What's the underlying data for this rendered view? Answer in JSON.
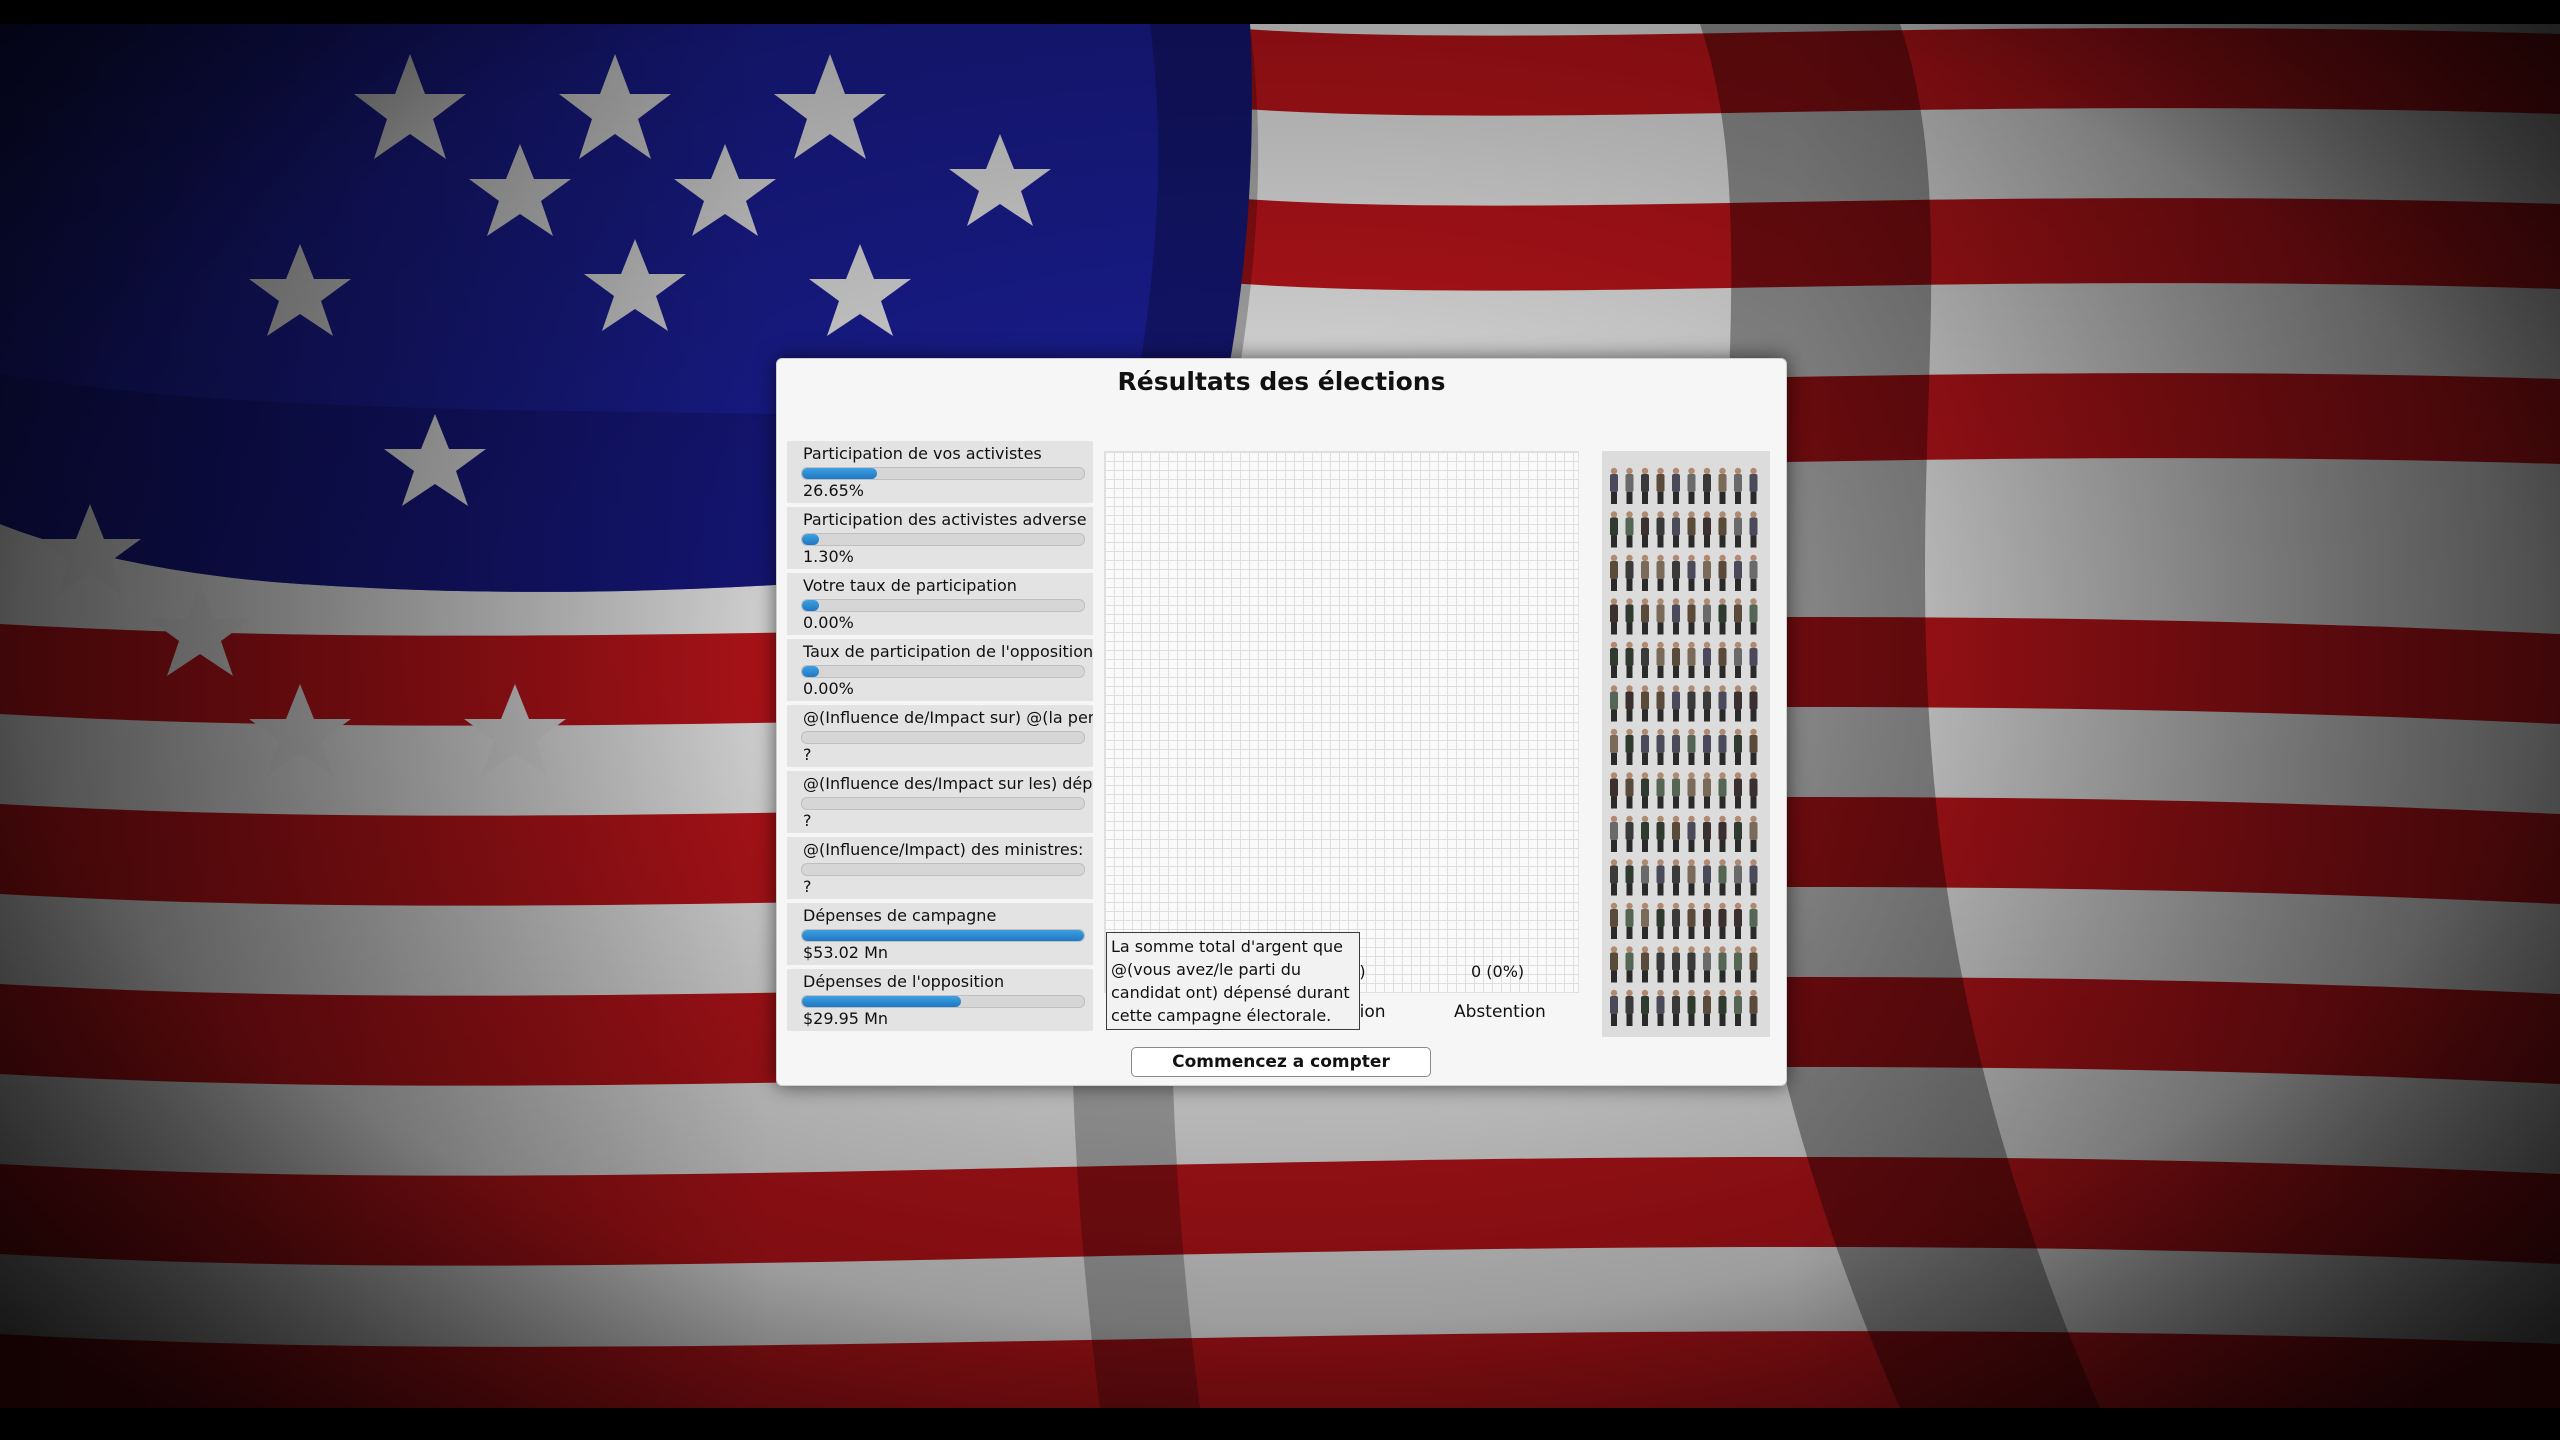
{
  "dialog": {
    "title": "Résultats des élections",
    "start_count_button": "Commencez a compter"
  },
  "stats": [
    {
      "label": "Participation de vos activistes",
      "value": "26.65%",
      "fill": 0.2665
    },
    {
      "label": "Participation des activistes adverse",
      "value": "1.30%",
      "fill": 0.013
    },
    {
      "label": "Votre taux de participation",
      "value": "0.00%",
      "fill": 0
    },
    {
      "label": "Taux de participation de l'opposition",
      "value": "0.00%",
      "fill": 0
    },
    {
      "label": "@(Influence de/Impact sur) @(la perception",
      "value": "?",
      "fill": null
    },
    {
      "label": "@(Influence des/Impact sur les) dépenses",
      "value": "?",
      "fill": null
    },
    {
      "label": "@(Influence/Impact) des ministres:",
      "value": "?",
      "fill": null
    },
    {
      "label": "Dépenses de campagne",
      "value": "$53.02 Mn",
      "fill": 1.0
    },
    {
      "label": "Dépenses de l'opposition",
      "value": "$29.95 Mn",
      "fill": 0.565
    }
  ],
  "chart": {
    "columns": [
      {
        "label": "tion",
        "value": "s)"
      },
      {
        "label": "Abstention",
        "value": "0 (0%)"
      }
    ]
  },
  "tooltip": {
    "text": "La somme total d'argent que @(vous avez/le parti du candidat ont) dépensé durant cette campagne électorale."
  },
  "colors": {
    "bar_fill": "#1f77c4",
    "panel_bg": "#f6f6f6",
    "stat_bg": "#e3e3e3"
  }
}
